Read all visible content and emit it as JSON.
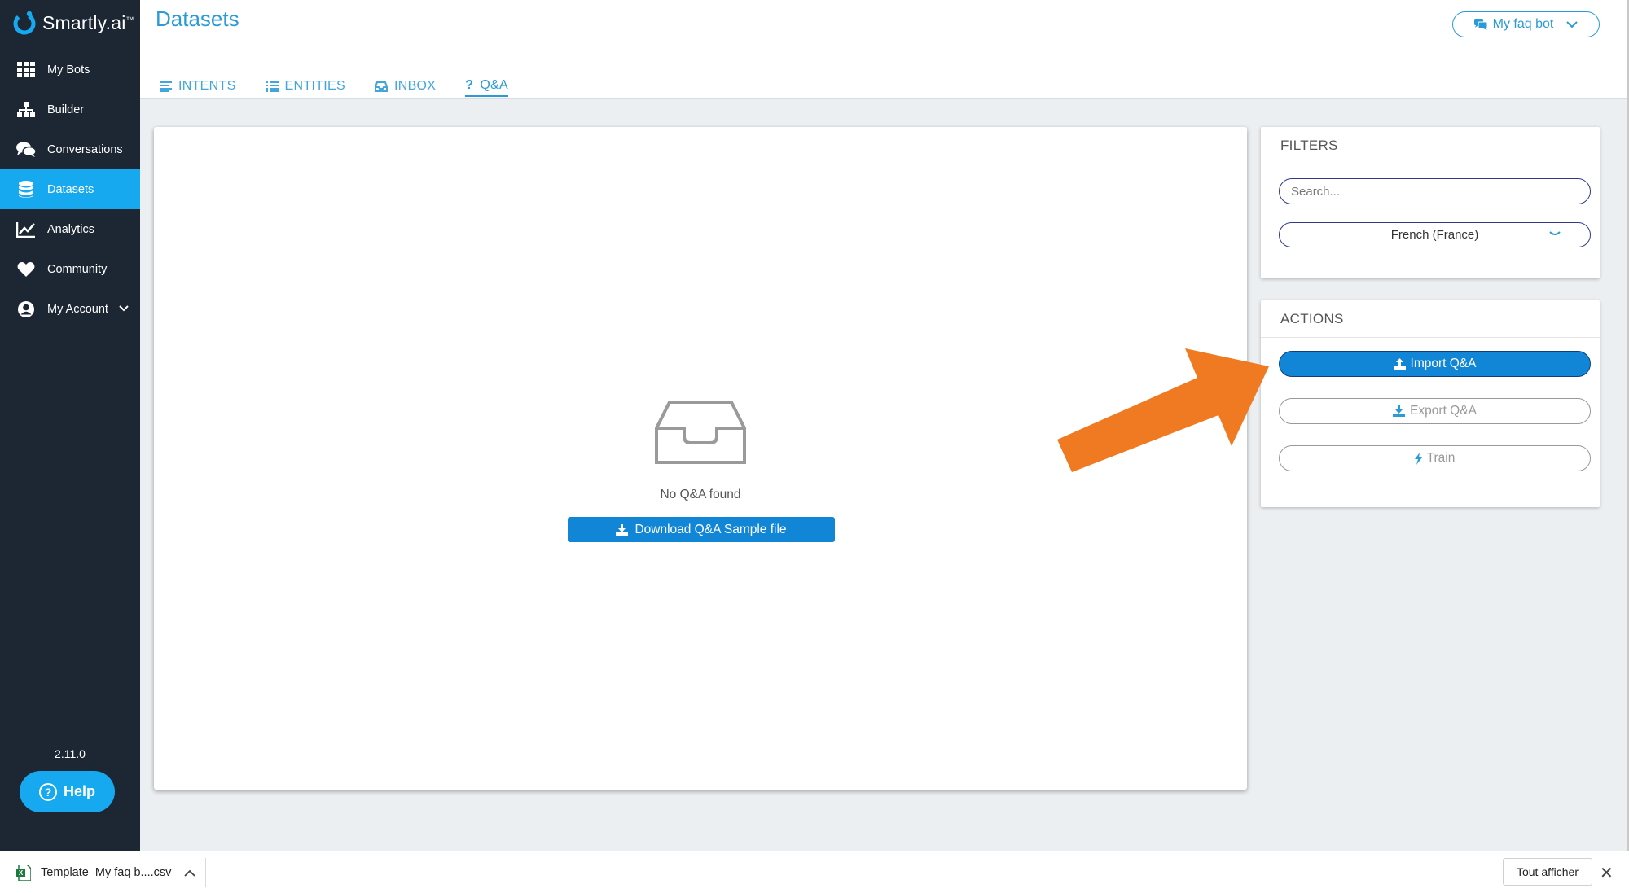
{
  "sidebar": {
    "logo_text": "Smartly.ai",
    "logo_tm": "™",
    "items": [
      {
        "label": "My Bots",
        "icon": "grid-icon"
      },
      {
        "label": "Builder",
        "icon": "sitemap-icon"
      },
      {
        "label": "Conversations",
        "icon": "chat-bubbles-icon"
      },
      {
        "label": "Datasets",
        "icon": "database-icon",
        "active": true
      },
      {
        "label": "Analytics",
        "icon": "line-chart-icon"
      },
      {
        "label": "Community",
        "icon": "heart-icon"
      },
      {
        "label": "My Account",
        "icon": "user-circle-icon"
      }
    ],
    "version": "2.11.0",
    "help_label": "Help",
    "help_icon_glyph": "?"
  },
  "header": {
    "page_title": "Datasets",
    "bot_selector_label": "My faq bot",
    "tabs": [
      {
        "label": "INTENTS",
        "icon": "align-left-icon"
      },
      {
        "label": "ENTITIES",
        "icon": "list-icon"
      },
      {
        "label": "INBOX",
        "icon": "inbox-icon"
      },
      {
        "label": "Q&A",
        "icon": "question-icon",
        "active": true
      }
    ],
    "qa_icon_glyph": "?"
  },
  "main": {
    "empty_text": "No Q&A found",
    "download_sample_label": "Download Q&A Sample file"
  },
  "filters": {
    "title": "FILTERS",
    "search_placeholder": "Search...",
    "language_value": "French (France)"
  },
  "actions": {
    "title": "ACTIONS",
    "import_label": "Import Q&A",
    "export_label": "Export Q&A",
    "train_label": "Train"
  },
  "download_bar": {
    "file_name": "Template_My faq b....csv",
    "show_all_label": "Tout afficher",
    "close_glyph": "✕"
  },
  "colors": {
    "sidebar_bg": "#1c2733",
    "accent": "#16a9f0",
    "primary_button": "#1185d6",
    "title_blue": "#2a9ad8",
    "arrow_orange": "#f07a22"
  }
}
